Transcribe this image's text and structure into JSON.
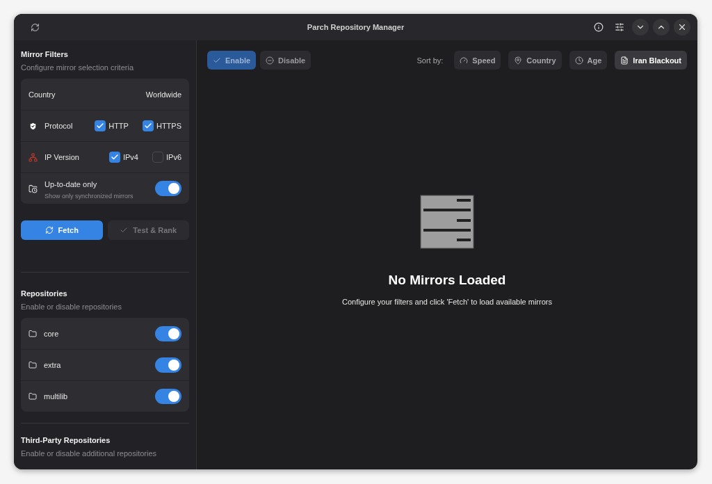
{
  "window": {
    "title": "Parch Repository Manager"
  },
  "filters": {
    "title": "Mirror Filters",
    "subtitle": "Configure mirror selection criteria",
    "country": {
      "label": "Country",
      "value": "Worldwide"
    },
    "protocol": {
      "label": "Protocol",
      "options": [
        {
          "label": "HTTP",
          "checked": true
        },
        {
          "label": "HTTPS",
          "checked": true
        }
      ]
    },
    "ip_version": {
      "label": "IP Version",
      "options": [
        {
          "label": "IPv4",
          "checked": true
        },
        {
          "label": "IPv6",
          "checked": false
        }
      ]
    },
    "up_to_date": {
      "label": "Up-to-date only",
      "description": "Show only synchronized mirrors",
      "on": true
    }
  },
  "actions": [
    {
      "label": "Fetch",
      "kind": "primary"
    },
    {
      "label": "Test & Rank",
      "kind": "secondary"
    }
  ],
  "repositories": {
    "title": "Repositories",
    "subtitle": "Enable or disable repositories",
    "items": [
      {
        "name": "core",
        "on": true
      },
      {
        "name": "extra",
        "on": true
      },
      {
        "name": "multilib",
        "on": true
      }
    ]
  },
  "third_party": {
    "title": "Third-Party Repositories",
    "subtitle": "Enable or disable additional repositories"
  },
  "toolbar": {
    "buttons": [
      {
        "label": "Enable",
        "kind": "enable"
      },
      {
        "label": "Disable",
        "kind": "disable"
      }
    ],
    "sort_label": "Sort by:",
    "sort_options": [
      {
        "label": "Speed",
        "kind": "speed",
        "selected": false
      },
      {
        "label": "Country",
        "kind": "country",
        "selected": false
      },
      {
        "label": "Age",
        "kind": "age",
        "selected": false
      },
      {
        "label": "Iran Blackout",
        "kind": "list",
        "selected": true
      }
    ]
  },
  "empty_state": {
    "title": "No Mirrors Loaded",
    "message": "Configure your filters and click 'Fetch' to load available mirrors"
  }
}
